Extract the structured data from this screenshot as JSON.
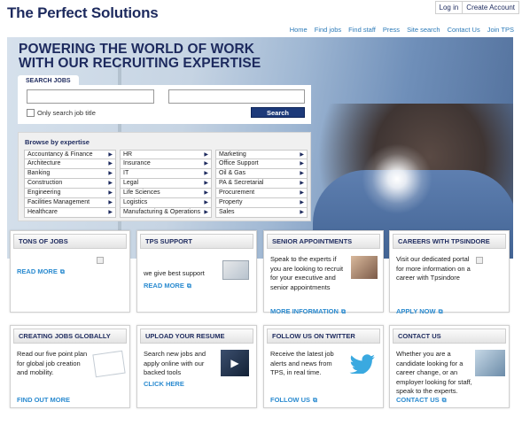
{
  "header": {
    "logo": "The Perfect Solutions",
    "account": [
      "Log in",
      "Create Account"
    ],
    "nav": [
      "Home",
      "Find jobs",
      "Find staff",
      "Press",
      "Site search",
      "Contact Us",
      "Join TPS"
    ]
  },
  "hero": {
    "headline_line1": "POWERING THE WORLD OF WORK",
    "headline_line2": "WITH OUR RECRUITING EXPERTISE"
  },
  "search": {
    "tab_label": "SEARCH JOBS",
    "keyword_value": "",
    "location_value": "",
    "checkbox_label": "Only search job title",
    "button_label": "Search"
  },
  "expertise": {
    "heading": "Browse by expertise",
    "columns": [
      [
        "Accountancy & Finance",
        "Architecture",
        "Banking",
        "Construction",
        "Engineering",
        "Facilities Management",
        "Healthcare"
      ],
      [
        "HR",
        "Insurance",
        "IT",
        "Legal",
        "Life Sciences",
        "Logistics",
        "Manufacturing & Operations"
      ],
      [
        "Marketing",
        "Office Support",
        "Oil & Gas",
        "PA & Secretarial",
        "Procurement",
        "Property",
        "Sales"
      ]
    ]
  },
  "cards": [
    {
      "title": "TONS OF JOBS",
      "text": "",
      "link": "READ MORE"
    },
    {
      "title": "TPS SUPPORT",
      "text": "we give best support",
      "link": "READ MORE"
    },
    {
      "title": "SENIOR APPOINTMENTS",
      "text": "Speak to the experts if you are looking to recruit for your executive and senior appointments",
      "link": "MORE INFORMATION"
    },
    {
      "title": "CAREERS WITH TPSINDORE",
      "text": "Visit our dedicated portal for more information on a career with Tpsindore",
      "link": "APPLY NOW"
    },
    {
      "title": "CREATING JOBS GLOBALLY",
      "text": "Read our five point plan for global job creation and mobility.",
      "link": "FIND OUT MORE"
    },
    {
      "title": "UPLOAD YOUR RESUME",
      "text": "Search new jobs and apply online with our backed tools",
      "link": "CLICK HERE"
    },
    {
      "title": "FOLLOW US ON TWITTER",
      "text": "Receive the latest job alerts and news from TPS, in real time.",
      "link": "FOLLOW US"
    },
    {
      "title": "CONTACT US",
      "text": "Whether you are a candidate looking for a career change, or an employer looking for staff, speak to the experts.",
      "link": "CONTACT US"
    }
  ],
  "icons": {
    "arrow": "chevron-right-icon",
    "external": "external-link-icon",
    "twitter": "twitter-bird-icon",
    "play": "play-icon"
  },
  "colors": {
    "brand_navy": "#1d2a5e",
    "link_blue": "#2b8bd0",
    "nav_blue": "#2b7ab8"
  }
}
